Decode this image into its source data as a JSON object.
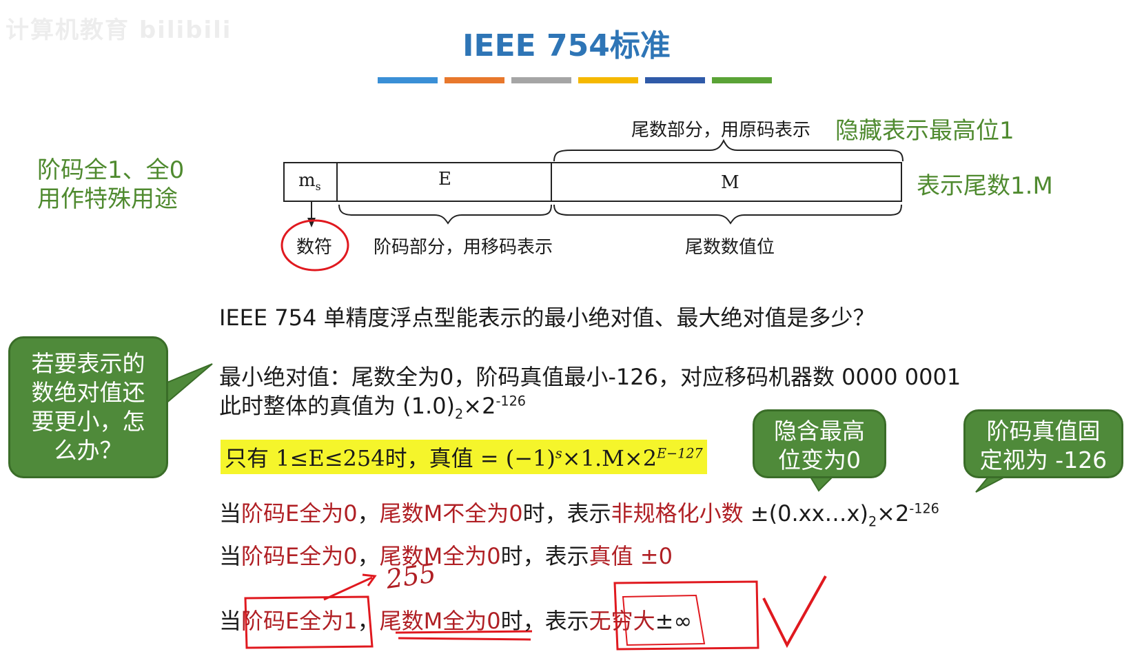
{
  "watermark": "计算机教育 bilibili",
  "title": "IEEE 754标准",
  "color_bars": [
    "#3a8fd6",
    "#e8782c",
    "#a5a5a5",
    "#f5b800",
    "#2f5aa8",
    "#5aa336"
  ],
  "side_note": {
    "line1": "阶码全1、全0",
    "line2": "用作特殊用途"
  },
  "top_note": "尾数部分，用原码表示",
  "top_note_green": "隐藏表示最高位1",
  "right_note": "表示尾数1.M",
  "fields": {
    "ms": "m",
    "ms_sub": "s",
    "e": "E",
    "m": "M"
  },
  "under_labels": {
    "sign": "数符",
    "exp": "阶码部分，用移码表示",
    "mant": "尾数数值位"
  },
  "question": "IEEE 754 单精度浮点型能表示的最小绝对值、最大绝对值是多少？",
  "min_line1": "最小绝对值：尾数全为0，阶码真值最小-126，对应移码机器数 0000 0001",
  "min_line2_pre": "此时整体的真值为 (1.0)",
  "min_line2_sub": "2",
  "min_line2_mid": "×2",
  "min_line2_sup": "-126",
  "condition": {
    "pre": "只有  1≤E≤254时，真值 = (−1)",
    "s": "s",
    "mid": "×1.M×2",
    "exp": "E−127"
  },
  "bubbles": {
    "b1": [
      "若要表示的",
      "数绝对值还",
      "要更小，怎",
      "么办？"
    ],
    "b2": [
      "隐含最高",
      "位变为0"
    ],
    "b3": [
      "阶码真值固",
      "定视为 -126"
    ]
  },
  "case1": {
    "p1": "当",
    "p2": "阶码E全为0",
    "p3": "，",
    "p4": "尾数M不全为0",
    "p5": "时，表示",
    "p6": "非规格化小数",
    "p7": " ±(0.xx…x)",
    "sub": "2",
    "p8": "×2",
    "sup": "-126"
  },
  "case2": {
    "p1": "当",
    "p2": "阶码E全为0",
    "p3": "，",
    "p4": "尾数M全为0",
    "p5": "时，表示",
    "p6": "真值 ±0"
  },
  "case3": {
    "p1": "当",
    "p2": "阶码E全为1",
    "p3": "，",
    "p4": "尾数M全为0",
    "p5": "时，表示",
    "p6": "无穷大",
    "p7": "±∞"
  },
  "handwritten": "255"
}
